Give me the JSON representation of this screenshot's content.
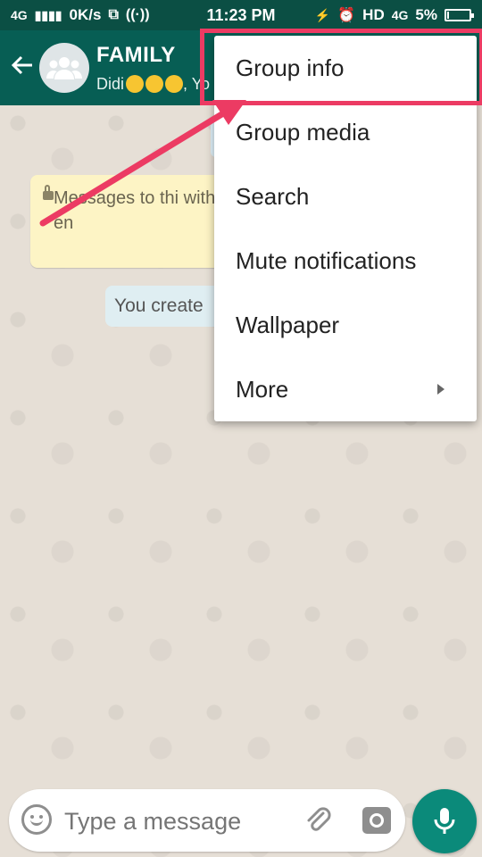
{
  "status_bar": {
    "network": "4G",
    "speed": "0K/s",
    "time": "11:23 PM",
    "hd": "HD",
    "network_right": "4G",
    "battery": "5%"
  },
  "header": {
    "title": "FAMILY",
    "subtitle": "Didi",
    "subtitle_suffix": ", Yo"
  },
  "chat": {
    "encryption_notice": "Messages to thi with end-to-end en",
    "created_notice": "You create"
  },
  "menu": {
    "items": [
      {
        "label": "Group info"
      },
      {
        "label": "Group media"
      },
      {
        "label": "Search"
      },
      {
        "label": "Mute notifications"
      },
      {
        "label": "Wallpaper"
      },
      {
        "label": "More"
      }
    ]
  },
  "composer": {
    "placeholder": "Type a message"
  },
  "colors": {
    "header": "#075e54",
    "accent": "#0b8a7a",
    "highlight": "#ec3b63"
  }
}
